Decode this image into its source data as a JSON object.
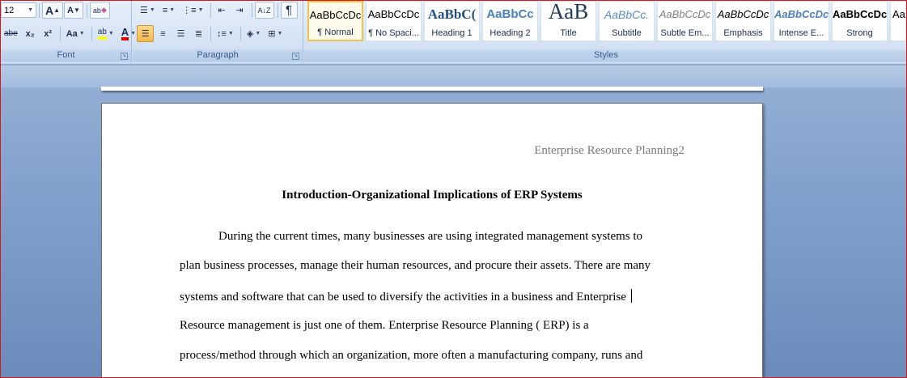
{
  "font_group": {
    "label": "Font",
    "font_size": "12",
    "grow_font": "A",
    "shrink_font": "A",
    "clear_format": "ab",
    "strike": "abe",
    "subscript": "x₂",
    "superscript": "x²",
    "change_case": "Aa",
    "highlight": "ab",
    "font_color": "A"
  },
  "paragraph_group": {
    "label": "Paragraph",
    "pilcrow": "¶"
  },
  "styles_group": {
    "label": "Styles",
    "tiles": [
      {
        "preview": "AaBbCcDc",
        "name": "¶ Normal"
      },
      {
        "preview": "AaBbCcDc",
        "name": "¶ No Spaci..."
      },
      {
        "preview": "AaBbC(",
        "name": "Heading 1"
      },
      {
        "preview": "AaBbCc",
        "name": "Heading 2"
      },
      {
        "preview": "AaB",
        "name": "Title"
      },
      {
        "preview": "AaBbCc.",
        "name": "Subtitle"
      },
      {
        "preview": "AaBbCcDc",
        "name": "Subtle Em..."
      },
      {
        "preview": "AaBbCcDc",
        "name": "Emphasis"
      },
      {
        "preview": "AaBbCcDc",
        "name": "Intense E..."
      },
      {
        "preview": "AaBbCcDc",
        "name": "Strong"
      },
      {
        "preview": "Aa",
        "name": ""
      }
    ]
  },
  "document": {
    "header": "Enterprise Resource Planning2",
    "title": "Introduction-Organizational  Implications  of  ERP Systems",
    "lines": [
      "During the current times, many businesses  are using integrated management  systems to",
      "plan business processes, manage their human resources, and procure their assets. There are many",
      "systems and software that can be used to diversify the activities in  a business and Enterprise",
      "Resource management is just one of them. Enterprise Resource Planning  (  ERP) is a",
      "process/method through which an  organization,  more often a manufacturing  company, runs and"
    ]
  },
  "colors": {
    "highlight": "#ffff00",
    "font_color": "#e00000",
    "accent": "#f2c24b"
  }
}
